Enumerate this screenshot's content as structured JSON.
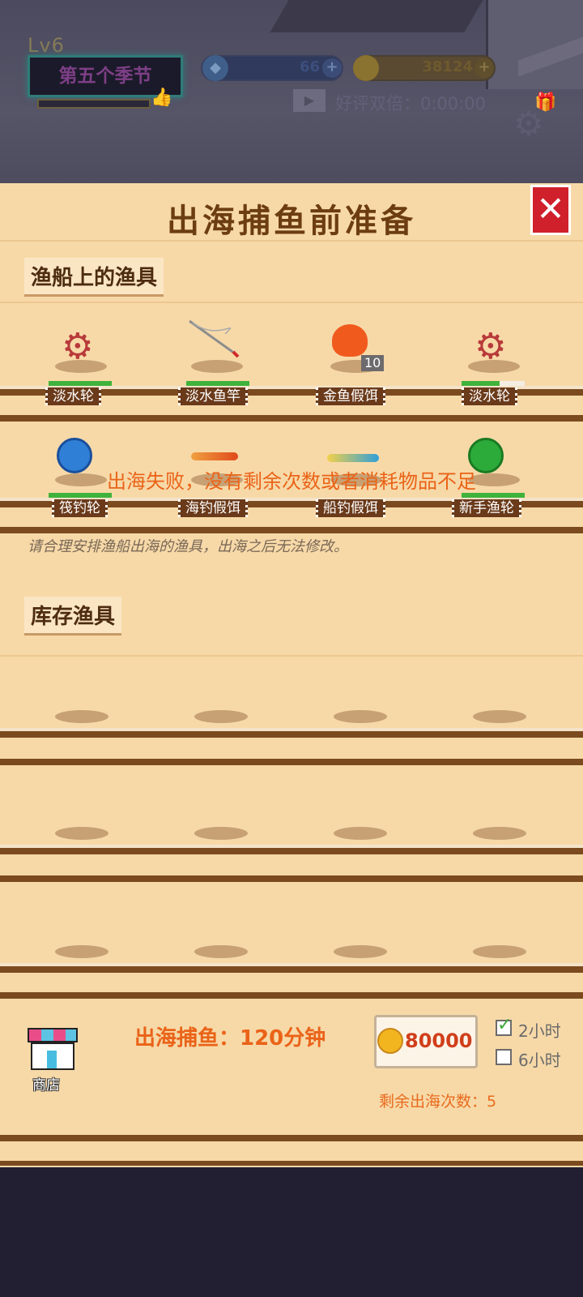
{
  "hud": {
    "level": "Lv6",
    "season": "第五个季节",
    "gems": "66",
    "coins": "38124",
    "double_reward": "好评双倍：0:00:00"
  },
  "panel": {
    "title": "出海捕鱼前准备",
    "close_label": "✕",
    "boat_section": "渔船上的渔具",
    "boat_items": [
      {
        "name": "淡水轮",
        "durability": 1.0
      },
      {
        "name": "淡水鱼竿",
        "durability": 1.0
      },
      {
        "name": "金鱼假饵",
        "count": "10"
      },
      {
        "name": "淡水轮",
        "durability": 0.6
      },
      {
        "name": "筏钓轮",
        "durability": 1.0
      },
      {
        "name": "海钓假饵"
      },
      {
        "name": "船钓假饵"
      },
      {
        "name": "新手渔轮",
        "durability": 1.0
      }
    ],
    "hint": "请合理安排渔船出海的渔具，出海之后无法修改。",
    "toast": "出海失败，没有剩余次数或者消耗物品不足",
    "inventory_section": "库存渔具"
  },
  "footer": {
    "shop_label": "商店",
    "fishing_time": "出海捕鱼：120分钟",
    "cost": "80000",
    "option_2h": "2小时",
    "option_6h": "6小时",
    "option_2h_checked": true,
    "option_6h_checked": false,
    "remaining": "剩余出海次数：5"
  },
  "colors": {
    "panel_bg": "#f7d9a8",
    "shelf": "#7b4a1f",
    "accent_orange": "#ea6318",
    "close_red": "#d0202b"
  }
}
